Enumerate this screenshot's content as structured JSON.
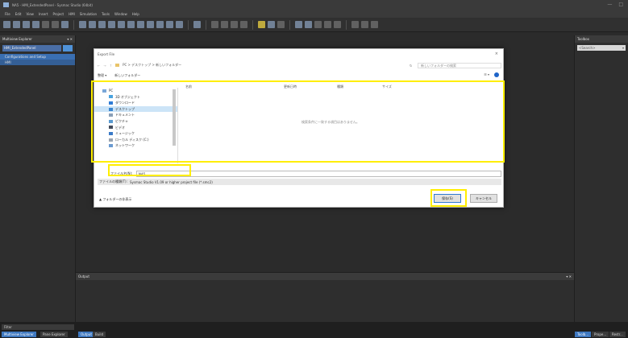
{
  "window": {
    "title": "NA5 - HMI_ExtendedPanel - Sysmac Studio (64bit)",
    "controls": [
      "—",
      "□"
    ]
  },
  "menu": [
    "File",
    "Edit",
    "View",
    "Insert",
    "Project",
    "HMI",
    "Simulation",
    "Tools",
    "Window",
    "Help"
  ],
  "left_panel": {
    "header": "Multiview Explorer",
    "selector": "HMI_ExtendedPanel",
    "items": [
      "Configurations and Setup",
      "HMI"
    ]
  },
  "right_panel": {
    "header": "Toolbox",
    "search_placeholder": "<Search>"
  },
  "output": {
    "header": "Output"
  },
  "bottom": {
    "filter": "Filter",
    "tabs": [
      "Multiview Explorer",
      "Pane Explorer",
      "Output",
      "Build",
      "Toolb...",
      "Prope...",
      "Restr..."
    ]
  },
  "dialog": {
    "title": "Export File",
    "close": "×",
    "breadcrumb": "PC  >  デスクトップ  >  新しいフォルダー",
    "search_placeholder": "新しいフォルダーの検索",
    "organize": "整理 ▾",
    "new_folder": "新しいフォルダー",
    "view_toggle": "☰ ▾",
    "nav_items": [
      "PC",
      "3D オブジェクト",
      "ダウンロード",
      "デスクトップ",
      "ドキュメント",
      "ピクチャ",
      "ビデオ",
      "ミュージック",
      "ローカル ディスク (C:)",
      "ネットワーク"
    ],
    "columns": [
      "名前",
      "更新日時",
      "種類",
      "サイズ"
    ],
    "empty_message": "検索条件に一致する項目はありません。",
    "file_name_label": "ファイル名(N):",
    "file_name_value": "NA5",
    "file_type_label": "ファイルの種類(T):",
    "file_type_value": "Sysmac Studio V1.09 or higher project file (*.smc2)",
    "hide_folders": "▲ フォルダーの非表示",
    "save_label": "保存(S)",
    "cancel_label": "キャンセル"
  },
  "highlight_color": "#ffee00"
}
